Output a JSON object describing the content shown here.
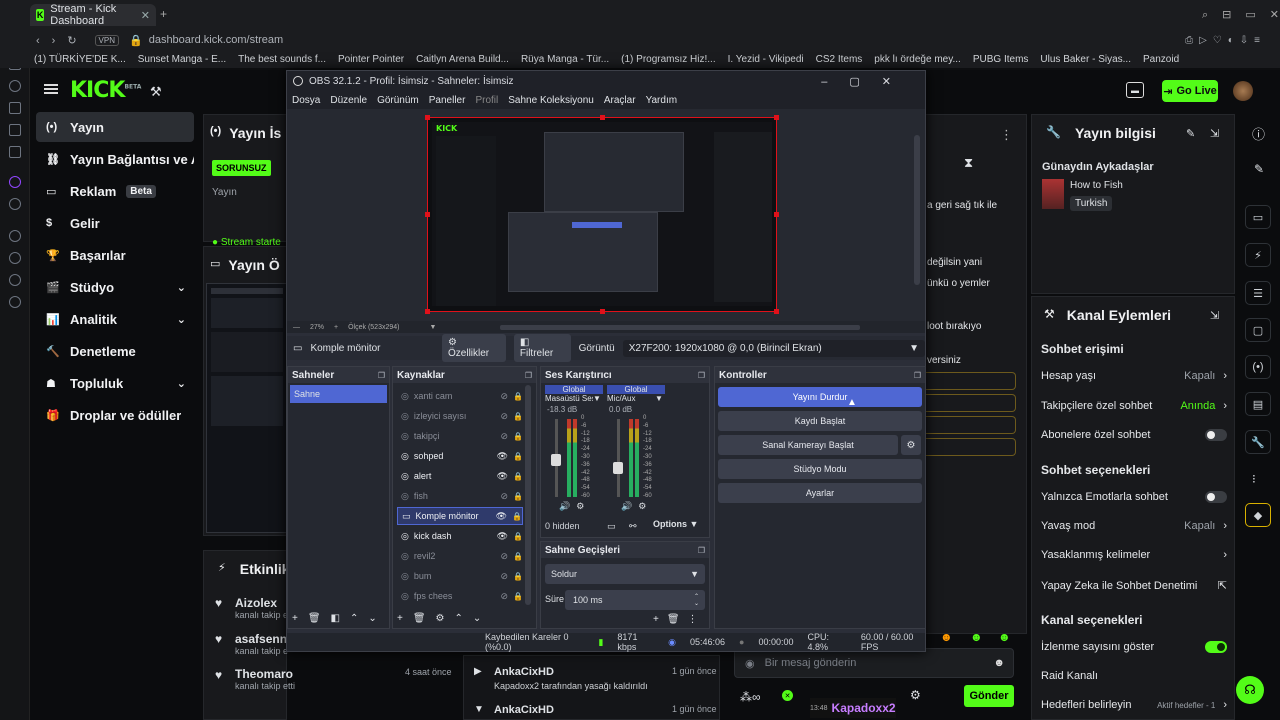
{
  "browser": {
    "tab_title": "Stream - Kick Dashboard",
    "url": "dashboard.kick.com/stream",
    "vpn": "VPN",
    "bookmarks": [
      "(1) TÜRKİYE'DE K...",
      "Sunset Manga - E...",
      "The best sounds f...",
      "Pointer Pointer",
      "Caitlyn Arena Build...",
      "Rüya Manga - Tür...",
      "(1) Programsız Hiz!...",
      "I. Yezid - Vikipedi",
      "CS2 Items",
      "pkk lı ördeğe mey...",
      "PUBG Items",
      "Ulus Baker - Siyas...",
      "Panzoid"
    ]
  },
  "kick": {
    "logo": "KICK",
    "logo_sup": "BETA",
    "go_live": "Go Live",
    "nav": [
      {
        "label": "Yayın",
        "icon": "broadcast-icon"
      },
      {
        "label": "Yayın Bağlantısı ve Anahtar",
        "icon": "link-icon"
      },
      {
        "label": "Reklam",
        "icon": "ad-icon",
        "badge": "Beta"
      },
      {
        "label": "Gelir",
        "icon": "revenue-icon"
      },
      {
        "label": "Başarılar",
        "icon": "trophy-icon"
      },
      {
        "label": "Stüdyo",
        "icon": "studio-icon"
      },
      {
        "label": "Analitik",
        "icon": "analytics-icon"
      },
      {
        "label": "Denetleme",
        "icon": "moderation-icon"
      },
      {
        "label": "Topluluk",
        "icon": "community-icon"
      },
      {
        "label": "Droplar ve ödüller",
        "icon": "drops-icon"
      }
    ],
    "panel_stream": {
      "title": "Yayın İs",
      "badge": "SORUNSUZ",
      "label": "Yayın",
      "status": "Stream starte"
    },
    "panel_preview": {
      "title": "Yayın Ö"
    },
    "activity": {
      "title": "Etkinlik",
      "items": [
        {
          "name": "Aizolex",
          "desc": "kanalı takip e"
        },
        {
          "name": "asafsenn",
          "desc": "kanalı takip e"
        },
        {
          "name": "Theomaro",
          "desc": "kanalı takip etti",
          "time": "4 saat önce"
        }
      ]
    },
    "moderation": {
      "items": [
        {
          "name": "AnkaCixHD",
          "desc": "Kapadoxx2 tarafından yasağı kaldırıldı",
          "desc_user": "Kapadoxx2",
          "time": "1 gün önce"
        },
        {
          "name": "AnkaCixHD",
          "time": "1 gün önce"
        }
      ]
    },
    "chat": {
      "lines": [
        "a geri sağ tık ile",
        "değilsin yani",
        "ünkü o yemler",
        "loot bırakıyo",
        "versiniz"
      ],
      "placeholder": "Bir mesaj gönderin",
      "send": "Gönder",
      "clock": "13:48",
      "user": "Kapadoxx2"
    },
    "stream_info": {
      "title": "Yayın bilgisi",
      "greeting": "Günaydın Aykadaşlar",
      "category": "How to Fish",
      "language": "Turkish"
    },
    "channel_actions": {
      "title": "Kanal Eylemleri",
      "chat_access": "Sohbet erişimi",
      "account_age": {
        "label": "Hesap yaşı",
        "value": "Kapalı"
      },
      "followers_only": {
        "label": "Takipçilere özel sohbet",
        "value": "Anında"
      },
      "subs_only": {
        "label": "Abonelere özel sohbet"
      },
      "chat_options": "Sohbet seçenekleri",
      "emote_only": {
        "label": "Yalnızca Emotlarla sohbet"
      },
      "slow_mode": {
        "label": "Yavaş mod",
        "value": "Kapalı"
      },
      "banned_words": {
        "label": "Yasaklanmış kelimeler"
      },
      "ai_moderation": {
        "label": "Yapay Zeka ile Sohbet Denetimi"
      },
      "channel_options": "Kanal seçenekleri",
      "show_views": {
        "label": "İzlenme sayısını göster"
      },
      "raid": {
        "label": "Raid Kanalı"
      },
      "goals": {
        "label": "Hedefleri belirleyin",
        "value": "Aktif hedefler - 1"
      }
    }
  },
  "obs": {
    "title": "OBS 32.1.2 - Profil: İsimsiz - Sahneler: İsimsiz",
    "menu": [
      "Dosya",
      "Düzenle",
      "Görünüm",
      "Paneller",
      "Profil",
      "Sahne Koleksiyonu",
      "Araçlar",
      "Yardım"
    ],
    "zoom": "27%",
    "scale": "Ölçek (523x294)",
    "source_bar": {
      "name": "Komple mönitor",
      "properties": "Özellikler",
      "filters": "Filtreler",
      "display_label": "Görüntü",
      "display_value": "X27F200: 1920x1080 @ 0,0 (Birincil Ekran)"
    },
    "scenes": {
      "title": "Sahneler",
      "items": [
        "Sahne"
      ]
    },
    "sources": {
      "title": "Kaynaklar",
      "items": [
        {
          "name": "xanti cam",
          "visible": false
        },
        {
          "name": "izleyici sayısı",
          "visible": false
        },
        {
          "name": "takipçi",
          "visible": false
        },
        {
          "name": "sohped",
          "visible": true
        },
        {
          "name": "alert",
          "visible": true
        },
        {
          "name": "fish",
          "visible": false
        },
        {
          "name": "Komple mönitor",
          "visible": true,
          "selected": true
        },
        {
          "name": "kick dash",
          "visible": true
        },
        {
          "name": "revil2",
          "visible": false
        },
        {
          "name": "bum",
          "visible": false
        },
        {
          "name": "fps chees",
          "visible": false
        }
      ]
    },
    "mixer": {
      "title": "Ses Karıştırıcı",
      "channels": [
        {
          "global": "Global",
          "name": "Masaüstü Ses",
          "db": "-18.3 dB",
          "level": 0.55
        },
        {
          "global": "Global",
          "name": "Mic/Aux",
          "db": "0.0 dB",
          "level": 0.45
        }
      ],
      "scale": [
        "0",
        "-6",
        "-12",
        "-18",
        "-24",
        "-30",
        "-36",
        "-42",
        "-48",
        "-54",
        "-60"
      ],
      "hidden": "0 hidden",
      "options": "Options"
    },
    "transitions": {
      "title": "Sahne Geçişleri",
      "type": "Soldur",
      "duration_label": "Süre",
      "duration": "100 ms"
    },
    "controls": {
      "title": "Kontroller",
      "buttons": [
        "Yayını Durdur",
        "Kaydı Başlat",
        "Sanal Kamerayı Başlat",
        "Stüdyo Modu",
        "Ayarlar"
      ]
    },
    "status": {
      "dropped": "Kaybedilen Kareler 0 (%0.0)",
      "bitrate": "8171 kbps",
      "stream_time": "05:46:06",
      "rec_time": "00:00:00",
      "cpu": "CPU: 4.8%",
      "fps": "60.00 / 60.00 FPS"
    }
  }
}
